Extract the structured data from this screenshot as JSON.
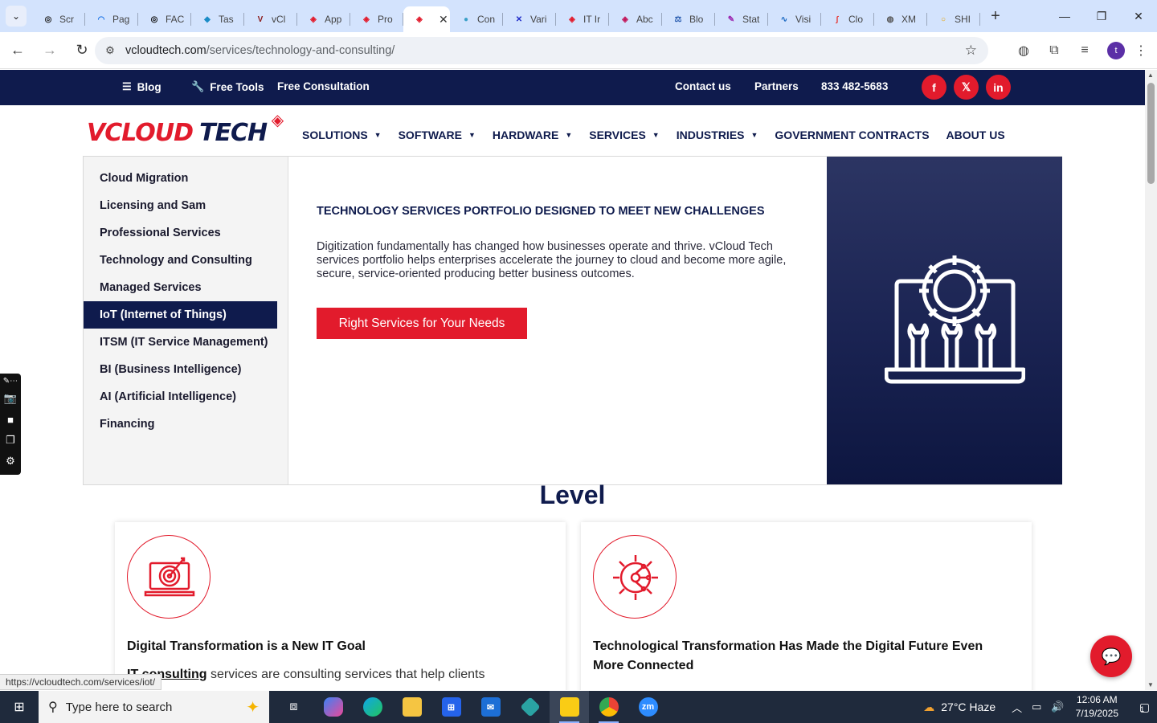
{
  "browser": {
    "tabs": [
      {
        "label": "Scr",
        "color": "#222222",
        "glyph": "◎"
      },
      {
        "label": "Pag",
        "color": "#1a73e8",
        "glyph": "◠"
      },
      {
        "label": "FAC",
        "color": "#111111",
        "glyph": "◎"
      },
      {
        "label": "Tas",
        "color": "#1a8cc7",
        "glyph": "◆"
      },
      {
        "label": "vCl",
        "color": "#8b1a1a",
        "glyph": "V"
      },
      {
        "label": "App",
        "color": "#e21b2c",
        "glyph": "◈"
      },
      {
        "label": "Pro",
        "color": "#e21b2c",
        "glyph": "◈"
      },
      {
        "label": "",
        "color": "#e21b2c",
        "glyph": "◈",
        "active": true
      },
      {
        "label": "Con",
        "color": "#3aa0c8",
        "glyph": "●"
      },
      {
        "label": "Vari",
        "color": "#1f2ac8",
        "glyph": "✕"
      },
      {
        "label": "IT Ir",
        "color": "#e21b2c",
        "glyph": "◈"
      },
      {
        "label": "Abc",
        "color": "#c2185b",
        "glyph": "◈"
      },
      {
        "label": "Blo",
        "color": "#2a5db0",
        "glyph": "⚖"
      },
      {
        "label": "Stat",
        "color": "#9c27b0",
        "glyph": "✎"
      },
      {
        "label": "Visi",
        "color": "#1565c0",
        "glyph": "∿"
      },
      {
        "label": "Clo",
        "color": "#e53935",
        "glyph": "∫"
      },
      {
        "label": "XM",
        "color": "#555555",
        "glyph": "◍"
      },
      {
        "label": "SHI",
        "color": "#e8a200",
        "glyph": "○"
      }
    ],
    "url_host": "vcloudtech.com",
    "url_path": "/services/technology-and-consulting/",
    "profile_initial": "t"
  },
  "topbar": {
    "blog": "Blog",
    "free_tools": "Free Tools",
    "free_consultation": "Free Consultation",
    "contact": "Contact us",
    "partners": "Partners",
    "phone": "833 482-5683",
    "social": [
      "f",
      "𝕏",
      "in"
    ]
  },
  "logo": {
    "v": "V",
    "cloud": "CLOUD",
    "tech": "TECH"
  },
  "nav": [
    {
      "label": "SOLUTIONS",
      "caret": true
    },
    {
      "label": "SOFTWARE",
      "caret": true
    },
    {
      "label": "HARDWARE",
      "caret": true
    },
    {
      "label": "SERVICES",
      "caret": true
    },
    {
      "label": "INDUSTRIES",
      "caret": true
    },
    {
      "label": "GOVERNMENT CONTRACTS",
      "caret": false
    },
    {
      "label": "ABOUT US",
      "caret": false
    }
  ],
  "services_menu": {
    "items": [
      "Cloud Migration",
      "Licensing and Sam",
      "Professional Services",
      "Technology and Consulting",
      "Managed Services",
      "IoT (Internet of Things)",
      "ITSM (IT Service Management)",
      "BI  (Business Intelligence)",
      "AI  (Artificial Intelligence)",
      "Financing"
    ],
    "active_index": 5,
    "heading": "TECHNOLOGY SERVICES PORTFOLIO DESIGNED TO MEET NEW CHALLENGES",
    "description": "Digitization fundamentally has changed how businesses operate and thrive. vCloud Tech services portfolio helps enterprises accelerate the journey to cloud and become more agile, secure, service-oriented producing better business outcomes.",
    "cta": "Right Services for Your Needs"
  },
  "section": {
    "heading": "Level",
    "cards": [
      {
        "title": "Digital Transformation is a New IT Goal",
        "link": "IT consulting",
        "text": " services are consulting services that help clients",
        "icon": "target-laptop-icon"
      },
      {
        "title": "Technological Transformation Has Made the Digital Future Even More Connected",
        "link": "",
        "text": "",
        "icon": "gear-network-icon"
      }
    ]
  },
  "status_url": "https://vcloudtech.com/services/iot/",
  "taskbar": {
    "search_placeholder": "Type here to search",
    "weather": "27°C  Haze",
    "time": "12:06 AM",
    "date": "7/19/2025",
    "notification_count": "1"
  }
}
